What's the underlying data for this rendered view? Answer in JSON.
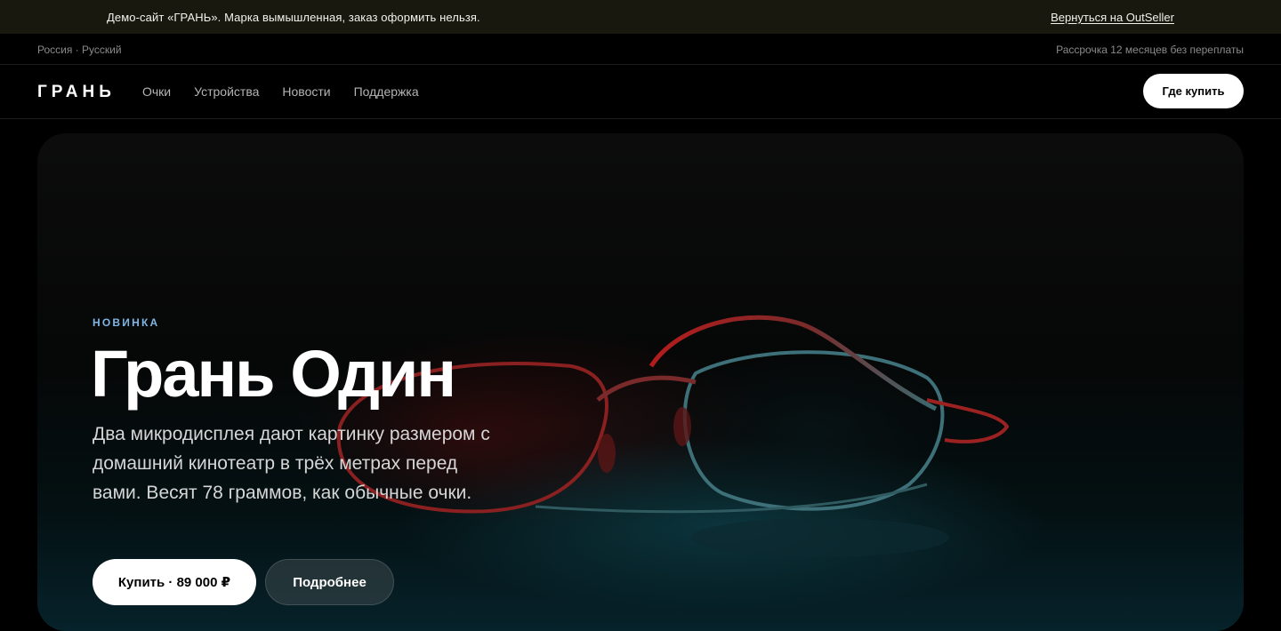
{
  "demo_banner": {
    "text": "Демо-сайт «ГРАНЬ». Марка вымышленная, заказ оформить нельзя.",
    "return_link": "Вернуться на OutSeller"
  },
  "util_bar": {
    "locale": "Россия · Русский",
    "promo": "Рассрочка 12 месяцев без переплаты"
  },
  "nav": {
    "logo": "ГРАНЬ",
    "links": [
      "Очки",
      "Устройства",
      "Новости",
      "Поддержка"
    ],
    "cta": "Где купить"
  },
  "hero": {
    "eyebrow": "НОВИНКА",
    "title": "Грань Один",
    "description": "Два микродисплея дают картинку размером с домашний кинотеатр в трёх метрах перед вами. Весят 78 граммов, как обычные очки.",
    "buy_button": "Купить · 89 000 ₽",
    "more_button": "Подробнее",
    "image_icon": "smart-glasses-photo"
  },
  "colors": {
    "banner_bg": "#19180f",
    "eyebrow_accent": "#7fb6e6",
    "page_bg": "#000000"
  }
}
